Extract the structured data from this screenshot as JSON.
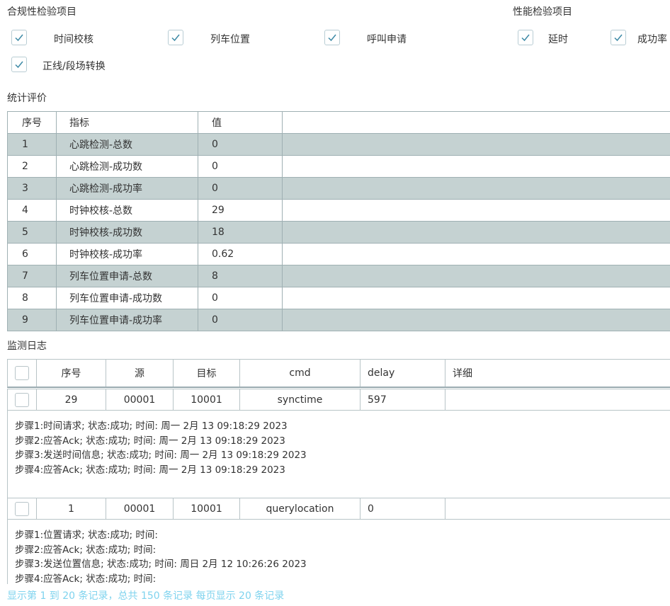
{
  "compliance": {
    "title": "合规性检验项目",
    "items": [
      {
        "label": "时间校核",
        "checked": true
      },
      {
        "label": "列车位置",
        "checked": true
      },
      {
        "label": "呼叫申请",
        "checked": true
      },
      {
        "label": "正线/段场转换",
        "checked": true
      }
    ]
  },
  "performance": {
    "title": "性能检验项目",
    "items": [
      {
        "label": "延时",
        "checked": true
      },
      {
        "label": "成功率",
        "checked": true
      }
    ]
  },
  "stats": {
    "title": "统计评价",
    "headers": [
      "序号",
      "指标",
      "值"
    ],
    "rows": [
      {
        "idx": "1",
        "name": "心跳检测-总数",
        "value": "0"
      },
      {
        "idx": "2",
        "name": "心跳检测-成功数",
        "value": "0"
      },
      {
        "idx": "3",
        "name": "心跳检测-成功率",
        "value": "0"
      },
      {
        "idx": "4",
        "name": "时钟校核-总数",
        "value": "29"
      },
      {
        "idx": "5",
        "name": "时钟校核-成功数",
        "value": "18"
      },
      {
        "idx": "6",
        "name": "时钟校核-成功率",
        "value": "0.62"
      },
      {
        "idx": "7",
        "name": "列车位置申请-总数",
        "value": "8"
      },
      {
        "idx": "8",
        "name": "列车位置申请-成功数",
        "value": "0"
      },
      {
        "idx": "9",
        "name": "列车位置申请-成功率",
        "value": "0"
      }
    ]
  },
  "log": {
    "title": "监测日志",
    "headers": [
      "序号",
      "源",
      "目标",
      "cmd",
      "delay",
      "详细"
    ],
    "rows": [
      {
        "seq": "29",
        "src": "00001",
        "dst": "10001",
        "cmd": "synctime",
        "delay": "597",
        "details": [
          "步骤1:时间请求; 状态:成功; 时间:  周一 2月 13 09:18:29 2023",
          "步骤2:应答Ack; 状态:成功; 时间:  周一 2月 13 09:18:29 2023",
          "步骤3:发送时间信息; 状态:成功; 时间:  周一 2月 13 09:18:29 2023",
          "步骤4:应答Ack; 状态:成功; 时间:  周一 2月 13 09:18:29 2023"
        ]
      },
      {
        "seq": "1",
        "src": "00001",
        "dst": "10001",
        "cmd": "querylocation",
        "delay": "0",
        "details": [
          "步骤1:位置请求; 状态:成功; 时间:",
          "步骤2:应答Ack; 状态:成功; 时间:",
          "步骤3:发送位置信息; 状态:成功; 时间:  周日 2月 12 10:26:26 2023",
          "步骤4:应答Ack; 状态:成功; 时间:"
        ]
      }
    ]
  },
  "footer": {
    "pagination_text": "显示第 1 到 20 条记录，总共 150 条记录  每页显示 20 条记录"
  },
  "colors": {
    "row_alt": "#c5d2d2",
    "checkbox_border": "#b9cdd4",
    "check_mark": "#3d8aa6",
    "footer_text": "#7fd3ee"
  }
}
